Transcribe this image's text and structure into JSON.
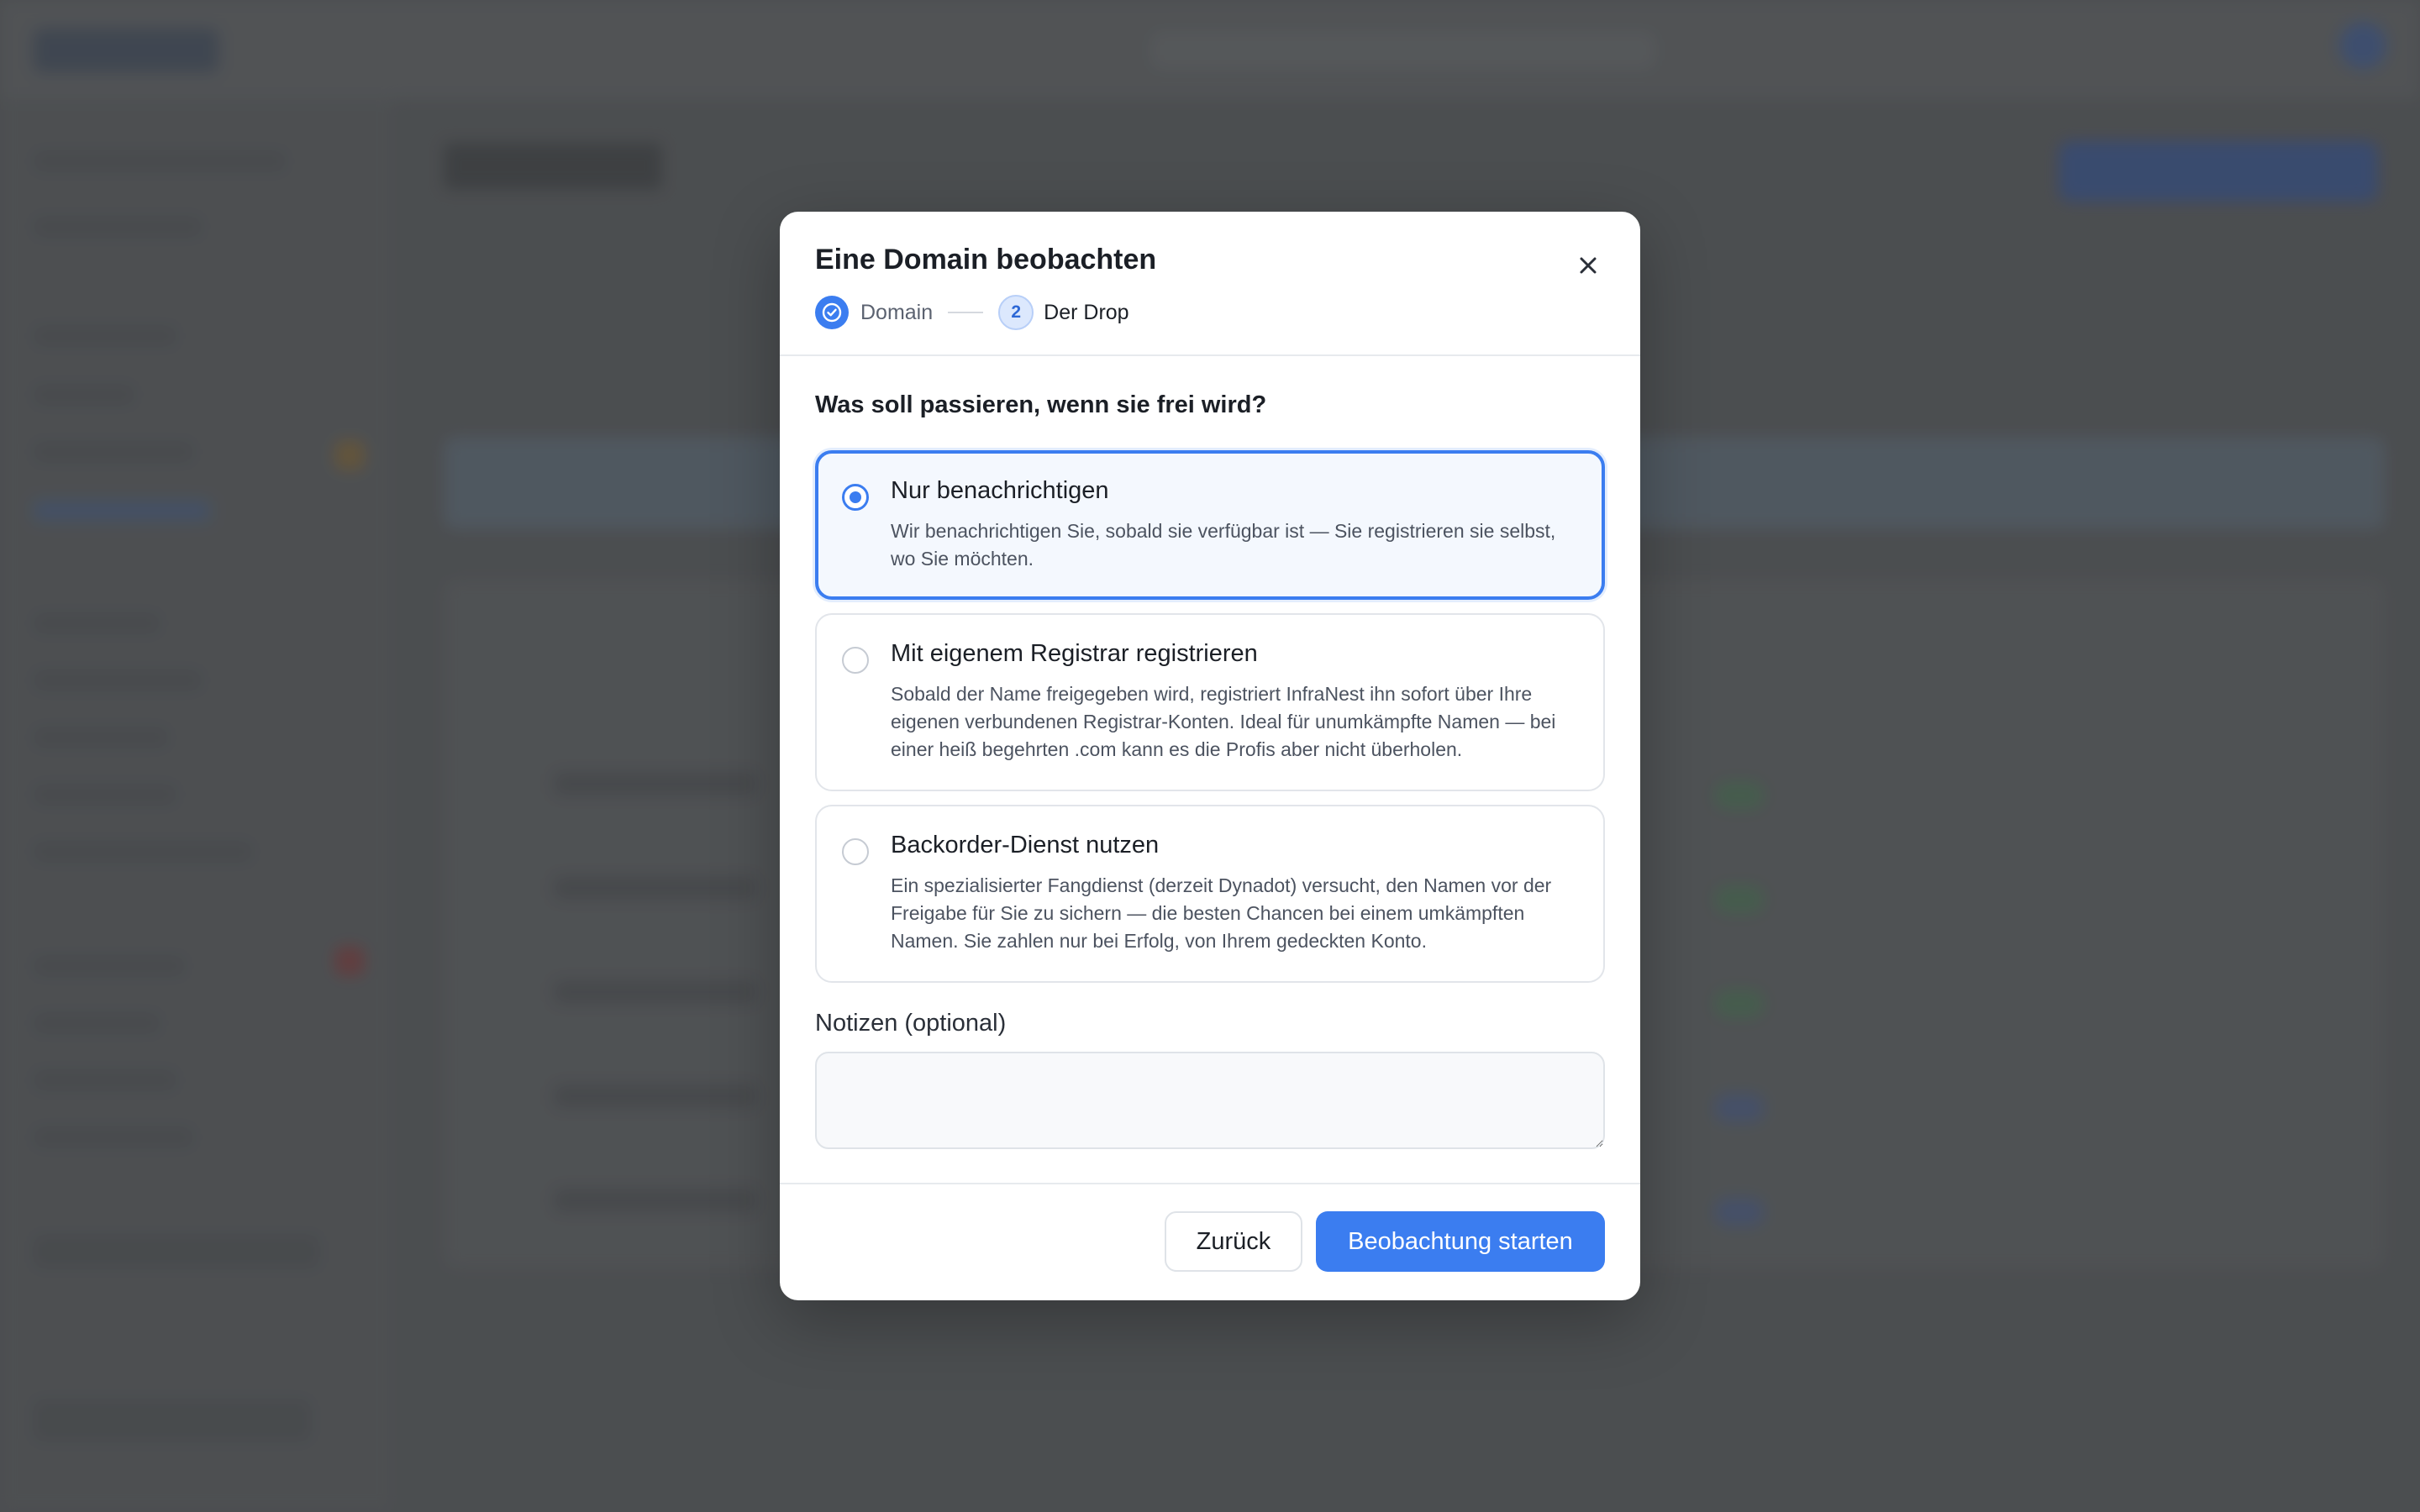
{
  "modal": {
    "title": "Eine Domain beobachten",
    "steps": [
      {
        "label": "Domain",
        "state": "done"
      },
      {
        "number": "2",
        "label": "Der Drop",
        "state": "current"
      }
    ],
    "question": "Was soll passieren, wenn sie frei wird?",
    "options": [
      {
        "title": "Nur benachrichtigen",
        "description": "Wir benachrichtigen Sie, sobald sie verfügbar ist — Sie registrieren sie selbst, wo Sie möchten.",
        "selected": true
      },
      {
        "title": "Mit eigenem Registrar registrieren",
        "description": "Sobald der Name freigegeben wird, registriert InfraNest ihn sofort über Ihre eigenen verbundenen Registrar-Konten. Ideal für unumkämpfte Namen — bei einer heiß begehrten .com kann es die Profis aber nicht überholen.",
        "selected": false
      },
      {
        "title": "Backorder-Dienst nutzen",
        "description": "Ein spezialisierter Fangdienst (derzeit Dynadot) versucht, den Namen vor der Freigabe für Sie zu sichern — die besten Chancen bei einem umkämpften Namen. Sie zahlen nur bei Erfolg, von Ihrem gedeckten Konto.",
        "selected": false
      }
    ],
    "notes": {
      "label": "Notizen (optional)",
      "value": "",
      "placeholder": ""
    },
    "buttons": {
      "back": "Zurück",
      "start": "Beobachtung starten"
    }
  },
  "colors": {
    "accent": "#3b7df0",
    "overlay": "#5f6163"
  },
  "icons": {
    "close": "close-icon",
    "step_done": "check-circle-icon"
  }
}
